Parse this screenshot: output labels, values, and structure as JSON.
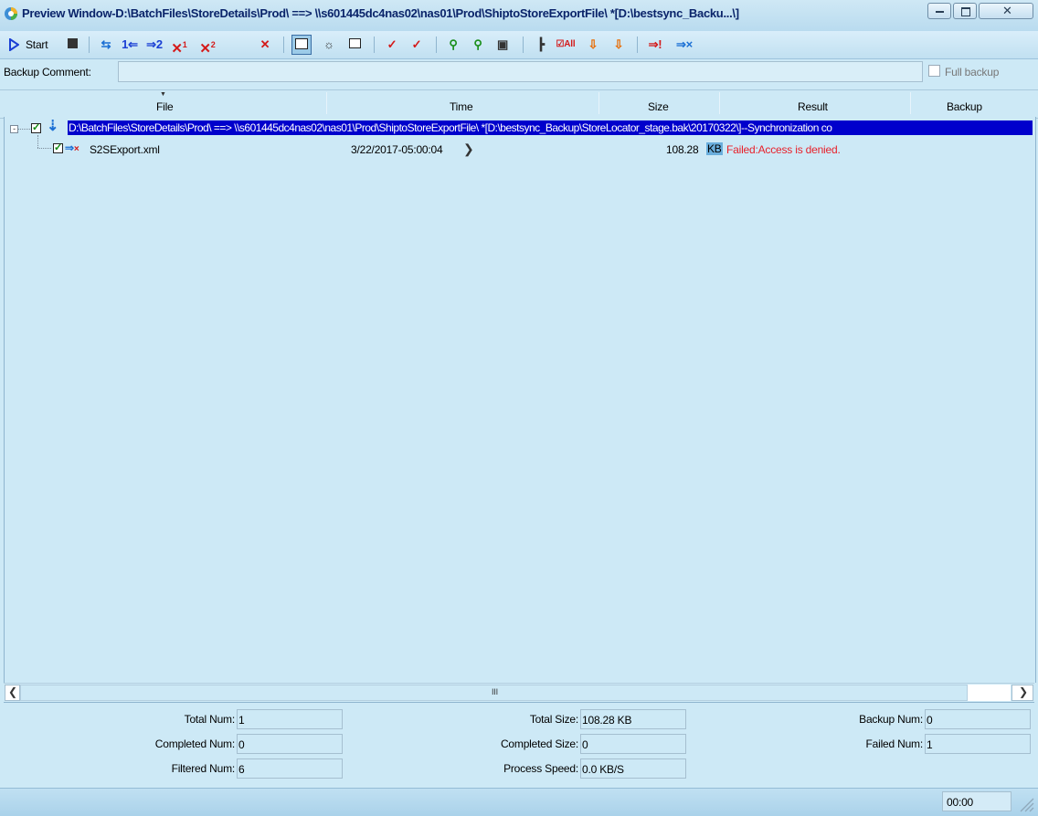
{
  "window": {
    "title": "Preview Window-D:\\BatchFiles\\StoreDetails\\Prod\\ ==> \\\\s601445dc4nas02\\nas01\\Prod\\ShiptoStoreExportFile\\ *[D:\\bestsync_Backu...\\]"
  },
  "toolbar": {
    "start_label": "Start"
  },
  "comment": {
    "label": "Backup Comment:",
    "value": "",
    "full_backup_label": "Full backup"
  },
  "columns": {
    "file": "File",
    "time": "Time",
    "size": "Size",
    "result": "Result",
    "backup": "Backup"
  },
  "tree": {
    "root_path": "D:\\BatchFiles\\StoreDetails\\Prod\\ ==> \\\\s601445dc4nas02\\nas01\\Prod\\ShiptoStoreExportFile\\ *[D:\\bestsync_Backup\\StoreLocator_stage.bak\\20170322\\]--Synchronization co",
    "item": {
      "name": "S2SExport.xml",
      "time": "3/22/2017-05:00:04",
      "size": "108.28",
      "size_unit": "KB",
      "result": "Failed:Access is denied."
    }
  },
  "scrollbar": {
    "thumb_glyph": "III"
  },
  "stats": {
    "total_num_label": "Total Num:",
    "total_num": "1",
    "completed_num_label": "Completed Num:",
    "completed_num": "0",
    "filtered_num_label": "Filtered Num:",
    "filtered_num": "6",
    "total_size_label": "Total Size:",
    "total_size": "108.28 KB",
    "completed_size_label": "Completed Size:",
    "completed_size": "0",
    "process_speed_label": "Process Speed:",
    "process_speed": "0.0 KB/S",
    "backup_num_label": "Backup Num:",
    "backup_num": "0",
    "failed_num_label": "Failed Num:",
    "failed_num": "1"
  },
  "status": {
    "timer": "00:00"
  },
  "colors": {
    "background": "#cde9f6",
    "selection": "#0000cc",
    "error_text": "#e8202a",
    "title_text": "#0a246a"
  }
}
